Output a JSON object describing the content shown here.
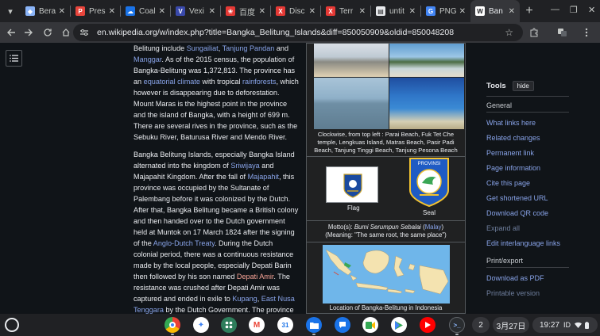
{
  "tabs": [
    {
      "title": "Bera",
      "favicon_color": "#8ab4f8",
      "favicon_glyph": "copilot-icon"
    },
    {
      "title": "Pres",
      "favicon_color": "#e8453c",
      "favicon_glyph": "P"
    },
    {
      "title": "Coal",
      "favicon_color": "#1a73e8",
      "favicon_glyph": "cloud-icon"
    },
    {
      "title": "Vexi",
      "favicon_color": "#3949ab",
      "favicon_glyph": "V"
    },
    {
      "title": "百度",
      "favicon_color": "#e53935",
      "favicon_glyph": "baidu-icon"
    },
    {
      "title": "Disc",
      "favicon_color": "#e53935",
      "favicon_glyph": "X"
    },
    {
      "title": "Terr",
      "favicon_color": "#e53935",
      "favicon_glyph": "X"
    },
    {
      "title": "untit",
      "favicon_color": "#e8eaed",
      "favicon_glyph": "doc-icon"
    },
    {
      "title": "PNG",
      "favicon_color": "#4285f4",
      "favicon_glyph": "G"
    },
    {
      "title": "Ban",
      "favicon_color": "#ffffff",
      "favicon_glyph": "W",
      "active": true
    }
  ],
  "window": {
    "minimize": "—",
    "restore": "❐",
    "close": "✕"
  },
  "toolbar": {
    "url": "en.wikipedia.org/w/index.php?title=Bangka_Belitung_Islands&diff=850050909&oldid=850048208"
  },
  "article": {
    "para1": [
      {
        "t": "Belitung include "
      },
      {
        "t": "Sungailiat",
        "link": true
      },
      {
        "t": ", "
      },
      {
        "t": "Tanjung Pandan",
        "link": true
      },
      {
        "t": " and "
      },
      {
        "t": "Manggar",
        "link": true
      },
      {
        "t": ". As of the 2015 census, the population of Bangka-Belitung was 1,372,813. The province has an "
      },
      {
        "t": "equatorial climate",
        "link": true
      },
      {
        "t": " with tropical "
      },
      {
        "t": "rainforests",
        "link": true
      },
      {
        "t": ", which however is disappearing due to deforestation. Mount Maras is the highest point in the province and the island of Bangka, with a height of 699 m. There are several rives in the province, such as the Sebuku River, Baturusa River and Mendo River."
      }
    ],
    "para2": [
      {
        "t": "Bangka Belitung Islands, especially Bangka Island alternated into the kingdom of "
      },
      {
        "t": "Sriwijaya",
        "link": true
      },
      {
        "t": " and Majapahit Kingdom. After the fall of "
      },
      {
        "t": "Majapahit",
        "link": true
      },
      {
        "t": ", this province was occupied by the Sultanate of Palembang before it was colonized by the Dutch. After that, Bangka Belitung became a British colony and then handed over to the Dutch government held at Muntok on 17 March 1824 after the signing of the "
      },
      {
        "t": "Anglo-Dutch Treaty",
        "link": true
      },
      {
        "t": ". During the Dutch colonial period, there was a continuous resistance made by the local people, especially Depati Barin then followed by his son named "
      },
      {
        "t": "Depati Amir",
        "link": true,
        "red": true
      },
      {
        "t": ". The resistance was crushed after Depati Amir was captured and ended in exile to "
      },
      {
        "t": "Kupang",
        "link": true
      },
      {
        "t": ", "
      },
      {
        "t": "East Nusa Tenggara",
        "link": true
      },
      {
        "t": " by the Dutch Government. The province"
      }
    ]
  },
  "infobox": {
    "photo_caption": "Clockwise, from top left : Parai Beach, Fuk Tet Che temple, Lengkuas Island, Matras Beach, Pasir Padi Beach, Tanjung Tinggi Beach, Tanjung Pesona Beach",
    "flag_label": "Flag",
    "seal_label": "Seal",
    "seal_text": "PROVINSI",
    "motto_prefix": "Motto(s): ",
    "motto": "Bumi Serumpun Sebalai",
    "motto_lang_open": " (",
    "motto_lang": "Malay",
    "motto_lang_close": ")",
    "motto_meaning": "(Meaning: \"The same root, the same place\")",
    "map_caption": "Location of Bangka-Belitung in Indonesia"
  },
  "sidebar": {
    "title": "Tools",
    "hide": "hide",
    "general": "General",
    "items": [
      "What links here",
      "Related changes",
      "Permanent link",
      "Page information",
      "Cite this page",
      "Get shortened URL",
      "Download QR code"
    ],
    "expand_all": "Expand all",
    "interlanguage": "Edit interlanguage links",
    "print_export": "Print/export",
    "pdf": "Download as PDF",
    "printable": "Printable version"
  },
  "shelf": {
    "notifications": "2",
    "date": "3月27日",
    "time": "19:27",
    "ime": "ID",
    "apps": [
      "chrome-icon",
      "gemini-icon",
      "app-launcher-icon",
      "gmail-icon",
      "calendar-icon",
      "files-icon",
      "messages-icon",
      "meet-icon",
      "play-store-icon",
      "youtube-icon",
      "terminal-icon"
    ]
  },
  "colors": {
    "link": "#88a3e8",
    "redlink": "#f9a598",
    "page_bg": "#101418",
    "chrome_bg": "#202124",
    "toolbar_bg": "#35363a"
  }
}
